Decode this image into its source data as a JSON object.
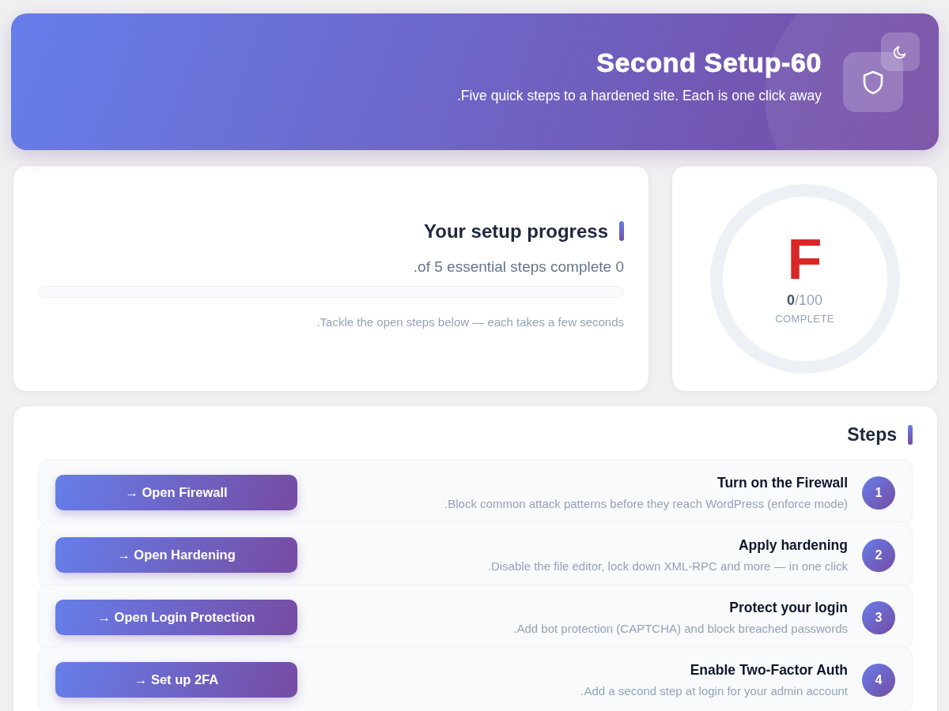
{
  "header": {
    "title": "Second Setup-60",
    "subtitle": ".Five quick steps to a hardened site. Each is one click away"
  },
  "progress": {
    "title": "Your setup progress",
    "summary": ".of 5 essential steps complete 0",
    "note": ".Tackle the open steps below — each takes a few seconds"
  },
  "score": {
    "grade": "F",
    "score": "**0**/100",
    "label": "COMPLETE"
  },
  "steps": {
    "title": "Steps",
    "items": [
      {
        "number": "1",
        "title": "Turn on the Firewall",
        "description": ".Block common attack patterns before they reach WordPress (enforce mode)",
        "action": "→ Open Firewall"
      },
      {
        "number": "2",
        "title": "Apply hardening",
        "description": ".Disable the file editor, lock down XML-RPC and more — in one click",
        "action": "→ Open Hardening"
      },
      {
        "number": "3",
        "title": "Protect your login",
        "description": ".Add bot protection (CAPTCHA) and block breached passwords",
        "action": "→ Open Login Protection"
      },
      {
        "number": "4",
        "title": "Enable Two-Factor Auth",
        "description": ".Add a second step at login for your admin account",
        "action": "→ Set up 2FA"
      }
    ]
  }
}
